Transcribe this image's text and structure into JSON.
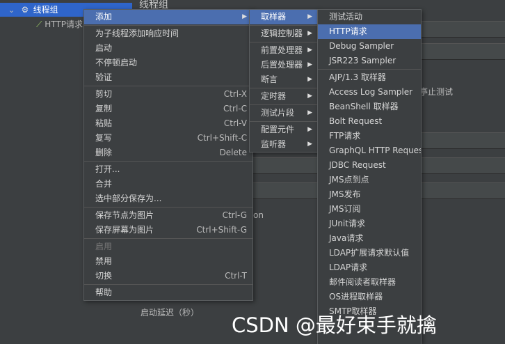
{
  "tree": {
    "thread_group": "线程组",
    "http_request": "HTTP请求"
  },
  "main": {
    "title": "线程组",
    "stop_test_fragment": "亭止测试",
    "on_fragment": "on",
    "startup_delay": "启动延迟（秒）"
  },
  "context_menu": {
    "add": "添加",
    "add_think_time": "为子线程添加响应时间",
    "start": "启动",
    "start_no_pause": "不停顿启动",
    "validate": "验证",
    "cut": "剪切",
    "cut_sc": "Ctrl-X",
    "copy": "复制",
    "copy_sc": "Ctrl-C",
    "paste": "粘贴",
    "paste_sc": "Ctrl-V",
    "duplicate": "复写",
    "duplicate_sc": "Ctrl+Shift-C",
    "delete": "删除",
    "delete_sc": "Delete",
    "open": "打开...",
    "merge": "合并",
    "save_selection": "选中部分保存为...",
    "save_node_image": "保存节点为图片",
    "save_node_image_sc": "Ctrl-G",
    "save_screen_image": "保存屏幕为图片",
    "save_screen_image_sc": "Ctrl+Shift-G",
    "enable": "启用",
    "disable": "禁用",
    "toggle": "切换",
    "toggle_sc": "Ctrl-T",
    "help": "帮助"
  },
  "add_menu": {
    "sampler": "取样器",
    "logic_controller": "逻辑控制器",
    "pre_processor": "前置处理器",
    "post_processor": "后置处理器",
    "assertion": "断言",
    "timer": "定时器",
    "test_fragment": "测试片段",
    "config_element": "配置元件",
    "listener": "监听器"
  },
  "sampler_menu": [
    "测试活动",
    "HTTP请求",
    "Debug Sampler",
    "JSR223 Sampler",
    "AJP/1.3 取样器",
    "Access Log Sampler",
    "BeanShell 取样器",
    "Bolt Request",
    "FTP请求",
    "GraphQL HTTP Request",
    "JDBC Request",
    "JMS点到点",
    "JMS发布",
    "JMS订阅",
    "JUnit请求",
    "Java请求",
    "LDAP扩展请求默认值",
    "LDAP请求",
    "邮件阅读者取样器",
    "OS进程取样器",
    "SMTP取样器"
  ],
  "watermark": "CSDN @最好束手就擒",
  "colors": {
    "highlight": "#4b6eaf",
    "tree_selected": "#2f65ca",
    "background": "#3c3f41"
  }
}
